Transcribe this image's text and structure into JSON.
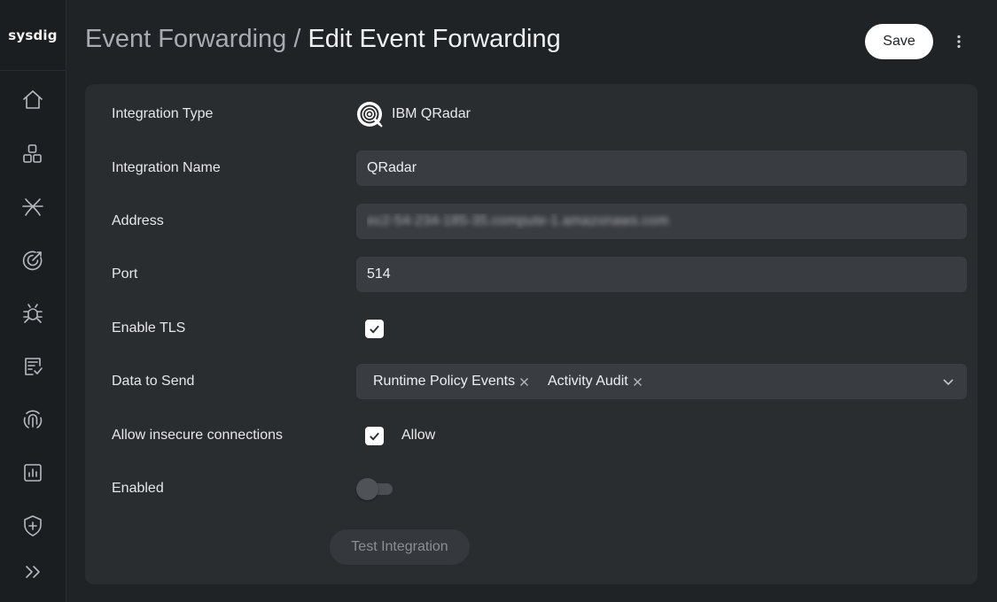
{
  "app": {
    "logo": "sysdig"
  },
  "sidebar": {
    "items": [
      {
        "icon": "home-icon"
      },
      {
        "icon": "inventory-icon"
      },
      {
        "icon": "integrations-icon"
      },
      {
        "icon": "posture-icon"
      },
      {
        "icon": "vulnerabilities-icon"
      },
      {
        "icon": "policies-icon"
      },
      {
        "icon": "identity-icon"
      },
      {
        "icon": "reports-icon"
      },
      {
        "icon": "shield-plus-icon"
      },
      {
        "icon": "expand-icon"
      }
    ]
  },
  "header": {
    "breadcrumb_parent": "Event Forwarding",
    "breadcrumb_separator": " / ",
    "breadcrumb_current": "Edit Event Forwarding",
    "save_label": "Save"
  },
  "form": {
    "integration_type": {
      "label": "Integration Type",
      "value": "IBM QRadar",
      "icon": "qradar-icon"
    },
    "integration_name": {
      "label": "Integration Name",
      "value": "QRadar"
    },
    "address": {
      "label": "Address",
      "value": "ec2-54-234-185-35.compute-1.amazonaws.com"
    },
    "port": {
      "label": "Port",
      "value": "514"
    },
    "enable_tls": {
      "label": "Enable TLS",
      "checked": true
    },
    "data_to_send": {
      "label": "Data to Send",
      "selected": [
        "Runtime Policy Events",
        "Activity Audit"
      ]
    },
    "allow_insecure": {
      "label": "Allow insecure connections",
      "checked": true,
      "option_label": "Allow"
    },
    "enabled": {
      "label": "Enabled",
      "on": false
    },
    "test_label": "Test Integration"
  },
  "colors": {
    "background": "#202326",
    "panel": "#2a2d30",
    "field": "#393c40",
    "save_button": "#ffffff"
  }
}
